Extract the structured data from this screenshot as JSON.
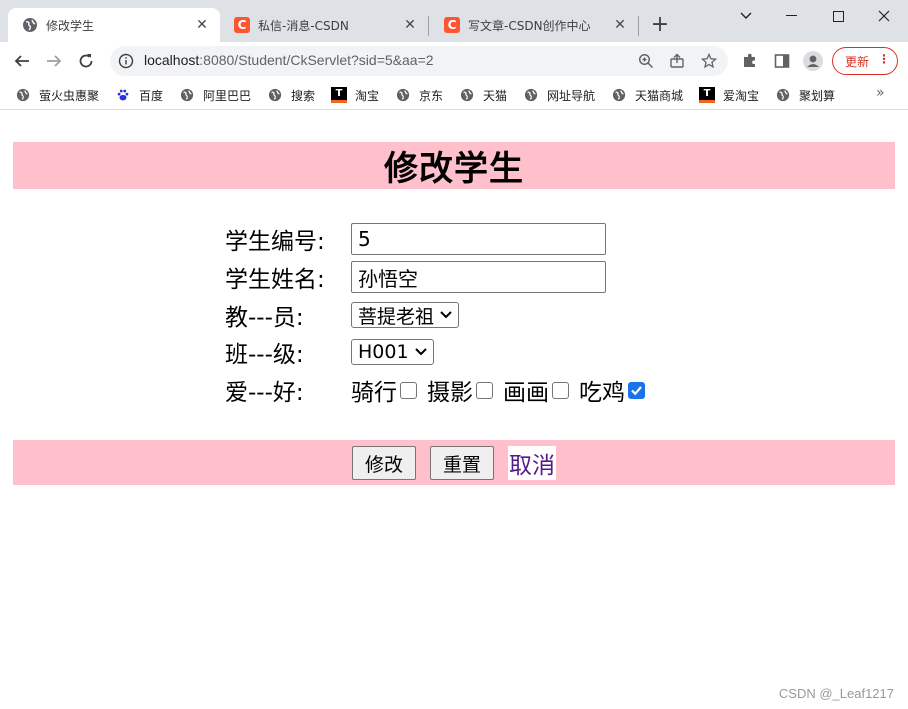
{
  "browser": {
    "tabs": [
      {
        "title": "修改学生",
        "active": true,
        "favicon": "globe-icon"
      },
      {
        "title": "私信-消息-CSDN",
        "active": false,
        "favicon": "csdn-icon"
      },
      {
        "title": "写文章-CSDN创作中心",
        "active": false,
        "favicon": "csdn-icon"
      }
    ],
    "csdn_favicon_letter": "C",
    "new_tab_symbol": "+",
    "url_host": "localhost",
    "url_rest": ":8080/Student/CkServlet?sid=5&aa=2",
    "update_label": "更新",
    "bookmarks": [
      {
        "label": "萤火虫惠聚",
        "icon": "globe-icon"
      },
      {
        "label": "百度",
        "icon": "baidu-paw-icon"
      },
      {
        "label": "阿里巴巴",
        "icon": "globe-icon"
      },
      {
        "label": "搜索",
        "icon": "globe-icon"
      },
      {
        "label": "淘宝",
        "icon": "tmall-icon"
      },
      {
        "label": "京东",
        "icon": "globe-icon"
      },
      {
        "label": "天猫",
        "icon": "globe-icon"
      },
      {
        "label": "网址导航",
        "icon": "globe-icon"
      },
      {
        "label": "天猫商城",
        "icon": "globe-icon"
      },
      {
        "label": "爱淘宝",
        "icon": "tmall-icon"
      },
      {
        "label": "聚划算",
        "icon": "globe-icon"
      }
    ],
    "tmall_icon_letter": "T",
    "bookmarks_overflow": "»",
    "accent_color": "#1a73e8"
  },
  "page": {
    "heading": "修改学生",
    "heading_bg": "#ffc0cb",
    "fields": {
      "sid_label": "学生编号:",
      "sid_value": "5",
      "name_label": "学生姓名:",
      "name_value": "孙悟空",
      "teacher_label": "教---员:",
      "teacher_value": "菩提老祖",
      "class_label": "班---级:",
      "class_value": "H001",
      "hobby_label": "爱---好:"
    },
    "hobbies": [
      {
        "label": "骑行",
        "checked": false
      },
      {
        "label": "摄影",
        "checked": false
      },
      {
        "label": "画画",
        "checked": false
      },
      {
        "label": "吃鸡",
        "checked": true
      }
    ],
    "buttons": {
      "submit": "修改",
      "reset": "重置",
      "cancel": "取消"
    }
  },
  "watermark": "CSDN @_Leaf1217"
}
